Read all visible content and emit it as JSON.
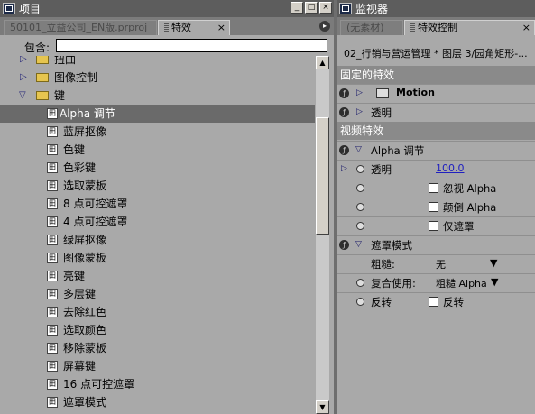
{
  "left_panel": {
    "title": "项目",
    "win_buttons": [
      "_",
      "□",
      "×"
    ],
    "tabs": [
      {
        "label": "50101_立益公司_EN版.prproj",
        "active": false
      },
      {
        "label": "特效",
        "active": true
      }
    ],
    "search": {
      "label": "包含:",
      "value": ""
    },
    "tree": [
      {
        "label": "扭曲",
        "kind": "folder",
        "expanded": false
      },
      {
        "label": "图像控制",
        "kind": "folder",
        "expanded": false
      },
      {
        "label": "键",
        "kind": "folder",
        "expanded": true
      },
      {
        "label": "Alpha 调节",
        "kind": "effect",
        "selected": true
      },
      {
        "label": "蓝屏抠像",
        "kind": "effect"
      },
      {
        "label": "色键",
        "kind": "effect"
      },
      {
        "label": "色彩键",
        "kind": "effect"
      },
      {
        "label": "选取蒙板",
        "kind": "effect"
      },
      {
        "label": "8 点可控遮罩",
        "kind": "effect"
      },
      {
        "label": "4 点可控遮罩",
        "kind": "effect"
      },
      {
        "label": "绿屏抠像",
        "kind": "effect"
      },
      {
        "label": "图像蒙板",
        "kind": "effect"
      },
      {
        "label": "亮键",
        "kind": "effect"
      },
      {
        "label": "多层键",
        "kind": "effect"
      },
      {
        "label": "去除红色",
        "kind": "effect"
      },
      {
        "label": "选取颜色",
        "kind": "effect"
      },
      {
        "label": "移除蒙板",
        "kind": "effect"
      },
      {
        "label": "屏幕键",
        "kind": "effect"
      },
      {
        "label": "16 点可控遮罩",
        "kind": "effect"
      },
      {
        "label": "遮罩模式",
        "kind": "effect"
      }
    ]
  },
  "right_panel": {
    "title": "监视器",
    "tabs": [
      {
        "label": "(无素材)",
        "active": false
      },
      {
        "label": "特效控制",
        "active": true
      }
    ],
    "clip_path": "02_行销与营运管理 * 图层 3/园角矩形-...",
    "fixed_header": "固定的特效",
    "motion_label": "Motion",
    "opacity_label": "透明",
    "video_header": "视频特效",
    "alpha_adjust": {
      "label": "Alpha 调节",
      "opacity_label": "透明",
      "opacity_value": "100.0",
      "ignore_alpha": "忽视 Alpha",
      "invert_alpha": "颠倒 Alpha",
      "mask_only": "仅遮罩"
    },
    "mask_mode": {
      "label": "遮罩模式",
      "roughness_label": "粗糙:",
      "roughness_value": "无",
      "composite_label": "复合使用:",
      "composite_value": "粗糙 Alpha",
      "reverse_label": "反转",
      "reverse_check_label": "反转"
    }
  }
}
